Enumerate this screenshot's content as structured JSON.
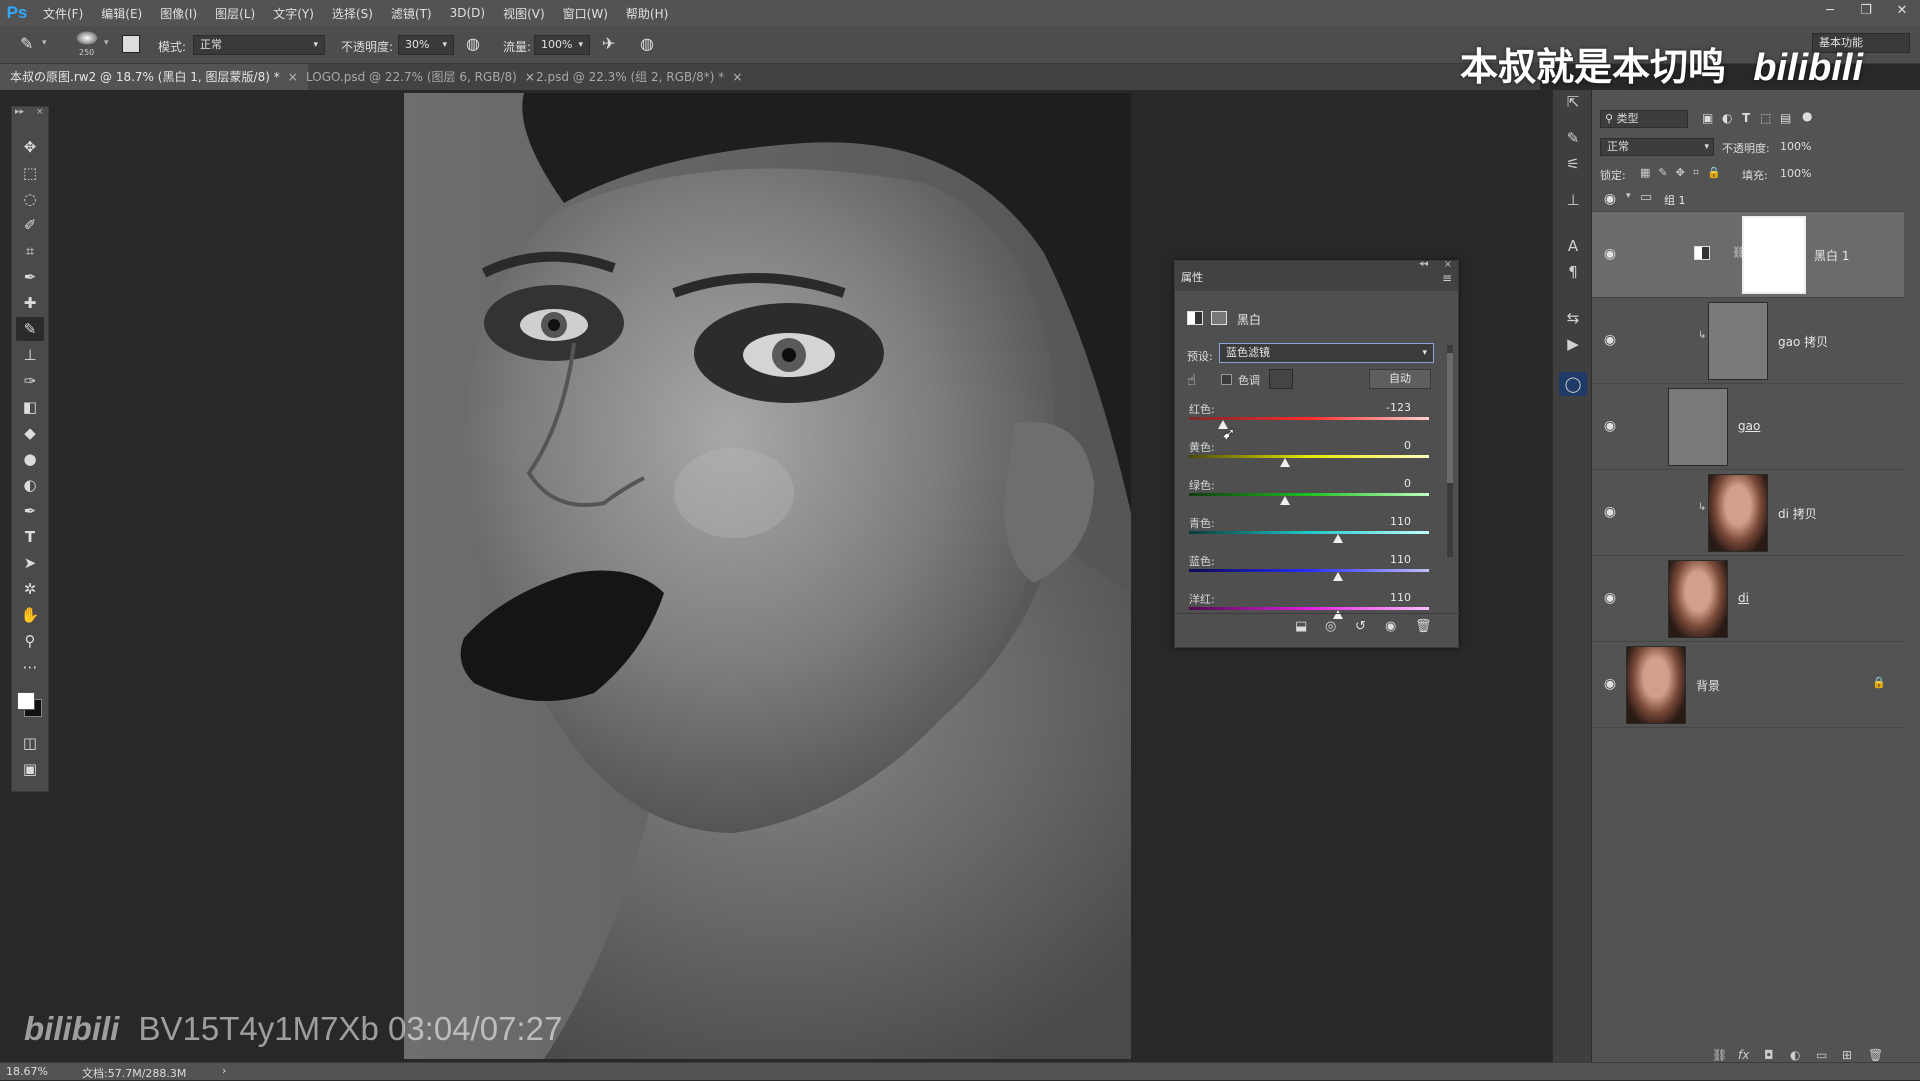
{
  "app": {
    "logo": "Ps",
    "menu": [
      "文件(F)",
      "编辑(E)",
      "图像(I)",
      "图层(L)",
      "文字(Y)",
      "选择(S)",
      "滤镜(T)",
      "3D(D)",
      "视图(V)",
      "窗口(W)",
      "帮助(H)"
    ],
    "window_buttons": [
      "─",
      "❐",
      "✕"
    ]
  },
  "options": {
    "brush_size": "250",
    "mode_label": "模式:",
    "mode_value": "正常",
    "opacity_label": "不透明度:",
    "opacity_value": "30%",
    "flow_label": "流量:",
    "flow_value": "100%",
    "workspace": "基本功能"
  },
  "tabs": [
    {
      "label": "本叔の原图.rw2 @ 18.7% (黑白 1, 图层蒙版/8) *",
      "active": true
    },
    {
      "label": "LOGO.psd @ 22.7% (图层 6, RGB/8)",
      "active": false
    },
    {
      "label": "2.psd @ 22.3% (组 2, RGB/8*) *",
      "active": false
    }
  ],
  "properties": {
    "tab": "属性",
    "type_label": "黑白",
    "preset_label": "预设:",
    "preset_value": "蓝色滤镜",
    "tint_label": "色调",
    "auto_button": "自动",
    "sliders": [
      {
        "name": "红色:",
        "value": "-123",
        "pos": 0.14,
        "gradient": "linear-gradient(to right,#7a2a2a,#ff2a2a,#ffd0d0)"
      },
      {
        "name": "黄色:",
        "value": "0",
        "pos": 0.4,
        "gradient": "linear-gradient(to right,#4a4a00,#e8e800,#ffffc0)"
      },
      {
        "name": "绿色:",
        "value": "0",
        "pos": 0.4,
        "gradient": "linear-gradient(to right,#0f3a0f,#20c020,#c0ffc0)"
      },
      {
        "name": "青色:",
        "value": "110",
        "pos": 0.62,
        "gradient": "linear-gradient(to right,#0a3a3a,#20c8c8,#c0ffff)"
      },
      {
        "name": "蓝色:",
        "value": "110",
        "pos": 0.62,
        "gradient": "linear-gradient(to right,#0a0a50,#2a2aff,#c0c0ff)"
      },
      {
        "name": "洋红:",
        "value": "110",
        "pos": 0.62,
        "gradient": "linear-gradient(to right,#500a50,#e020e0,#ffc0ff)"
      }
    ]
  },
  "layers_panel": {
    "filter_label": "类型",
    "blend_mode": "正常",
    "opacity_label": "不透明度:",
    "opacity_value": "100%",
    "lock_label": "锁定:",
    "fill_label": "填充:",
    "fill_value": "100%",
    "group_name": "组 1",
    "layers": [
      {
        "name": "黑白 1"
      },
      {
        "name": "gao 拷贝"
      },
      {
        "name": "gao"
      },
      {
        "name": "di 拷贝"
      },
      {
        "name": "di"
      },
      {
        "name": "背景"
      }
    ]
  },
  "status": {
    "zoom": "18.67%",
    "doc": "文档:57.7M/288.3M"
  },
  "watermark": {
    "top_text": "本叔就是本切鸣",
    "brand": "bilibili",
    "bottom_text": "BV15T4y1M7Xb 03:04/07:27"
  }
}
